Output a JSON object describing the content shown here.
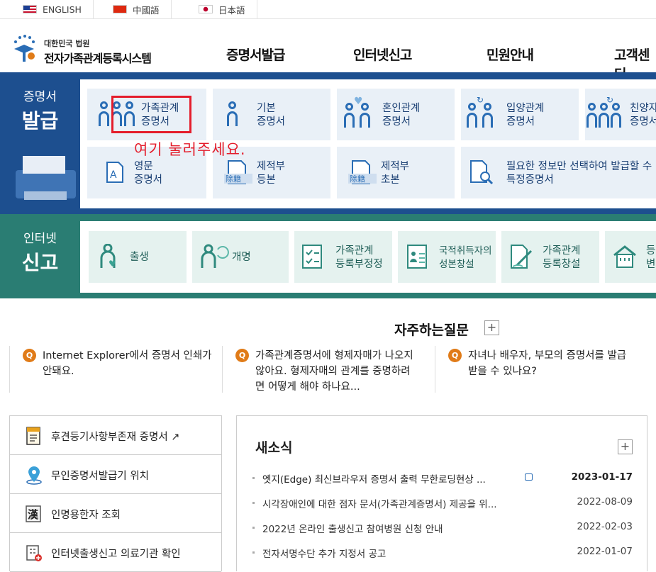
{
  "languages": [
    "ENGLISH",
    "中國語",
    "日本語"
  ],
  "logo": {
    "sub": "대한민국 법원",
    "main": "전자가족관계등록시스템"
  },
  "gnb": [
    "증명서발급",
    "인터넷신고",
    "민원안내",
    "고객센터"
  ],
  "issue": {
    "label_top": "증명서",
    "label_bottom": "발급",
    "tiles": [
      {
        "label": "가족관계\n증명서"
      },
      {
        "label": "기본\n증명서"
      },
      {
        "label": "혼인관계\n증명서"
      },
      {
        "label": "입양관계\n증명서"
      },
      {
        "label": "친양자\n증명서"
      },
      {
        "label": "영문\n증명서"
      },
      {
        "label": "제적부\n등본"
      },
      {
        "label": "제적부\n초본"
      },
      {
        "label": "필요한 정보만 선택하여 발급할 수\n특정증명서"
      }
    ]
  },
  "annotation": "여기 눌러주세요.",
  "report": {
    "label_top": "인터넷",
    "label_bottom": "신고",
    "tiles": [
      {
        "label": "출생"
      },
      {
        "label": "개명"
      },
      {
        "label": "가족관계\n등록부정정"
      },
      {
        "label": "국적취득자의\n성본창설"
      },
      {
        "label": "가족관계\n등록창설"
      },
      {
        "label": "등\n변"
      }
    ]
  },
  "faq": {
    "title": "자주하는질문",
    "items": [
      {
        "text": "Internet Explorer에서 증명서 인쇄가\n안돼요."
      },
      {
        "text": "가족관계증명서에 형제자매가 나오지\n않아요. 형제자매의 관계를 증명하려\n면 어떻게 해야 하나요..."
      },
      {
        "text": "자녀나 배우자, 부모의 증명서를 발급\n받을 수 있나요?"
      }
    ]
  },
  "quick": [
    {
      "label": "후견등기사항부존재 증명서 ↗"
    },
    {
      "label": "무인증명서발급기 위치"
    },
    {
      "label": "인명용한자 조회"
    },
    {
      "label": "인터넷출생신고 의료기관 확인"
    }
  ],
  "news": {
    "title": "새소식",
    "items": [
      {
        "title": "엣지(Edge) 최신브라우저 증명서 출력 무한로딩현상 ...",
        "date": "2023-01-17"
      },
      {
        "title": "시각장애인에 대한 점자 문서(가족관계증명서) 제공을 위...",
        "date": "2022-08-09"
      },
      {
        "title": "2022년 온라인 출생신고 참여병원 신청 안내",
        "date": "2022-02-03"
      },
      {
        "title": "전자서명수단 추가 지정서 공고",
        "date": "2022-01-07"
      }
    ]
  },
  "colors": {
    "issue_band": "#1d4f8f",
    "report_band": "#2a7d73",
    "highlight": "#e41d2b",
    "faq_q": "#e07b18"
  }
}
